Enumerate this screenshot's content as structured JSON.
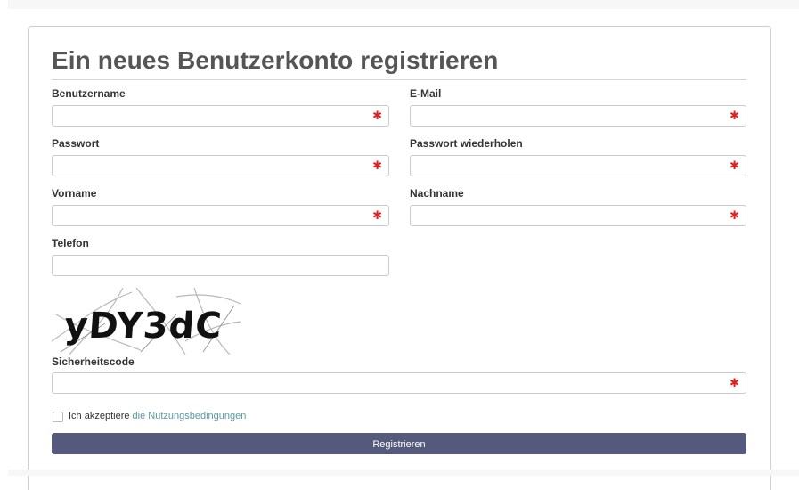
{
  "form": {
    "title": "Ein neues Benutzerkonto registrieren",
    "required_marker": "✱",
    "fields": {
      "username": {
        "label": "Benutzername",
        "value": "",
        "required": true
      },
      "email": {
        "label": "E-Mail",
        "value": "",
        "required": true
      },
      "password": {
        "label": "Passwort",
        "value": "",
        "required": true
      },
      "password_repeat": {
        "label": "Passwort wiederholen",
        "value": "",
        "required": true
      },
      "firstname": {
        "label": "Vorname",
        "value": "",
        "required": true
      },
      "lastname": {
        "label": "Nachname",
        "value": "",
        "required": true
      },
      "phone": {
        "label": "Telefon",
        "value": "",
        "required": false
      },
      "security_code": {
        "label": "Sicherheitscode",
        "value": "",
        "required": true
      }
    },
    "captcha": {
      "text": "yDY3dC"
    },
    "terms": {
      "prefix": "Ich akzeptiere",
      "link_text": "die Nutzungsbedingungen",
      "checked": false
    },
    "submit_label": "Registrieren"
  },
  "colors": {
    "button_bg": "#555a7c",
    "required": "#e02020",
    "link": "#5b9aa0"
  }
}
